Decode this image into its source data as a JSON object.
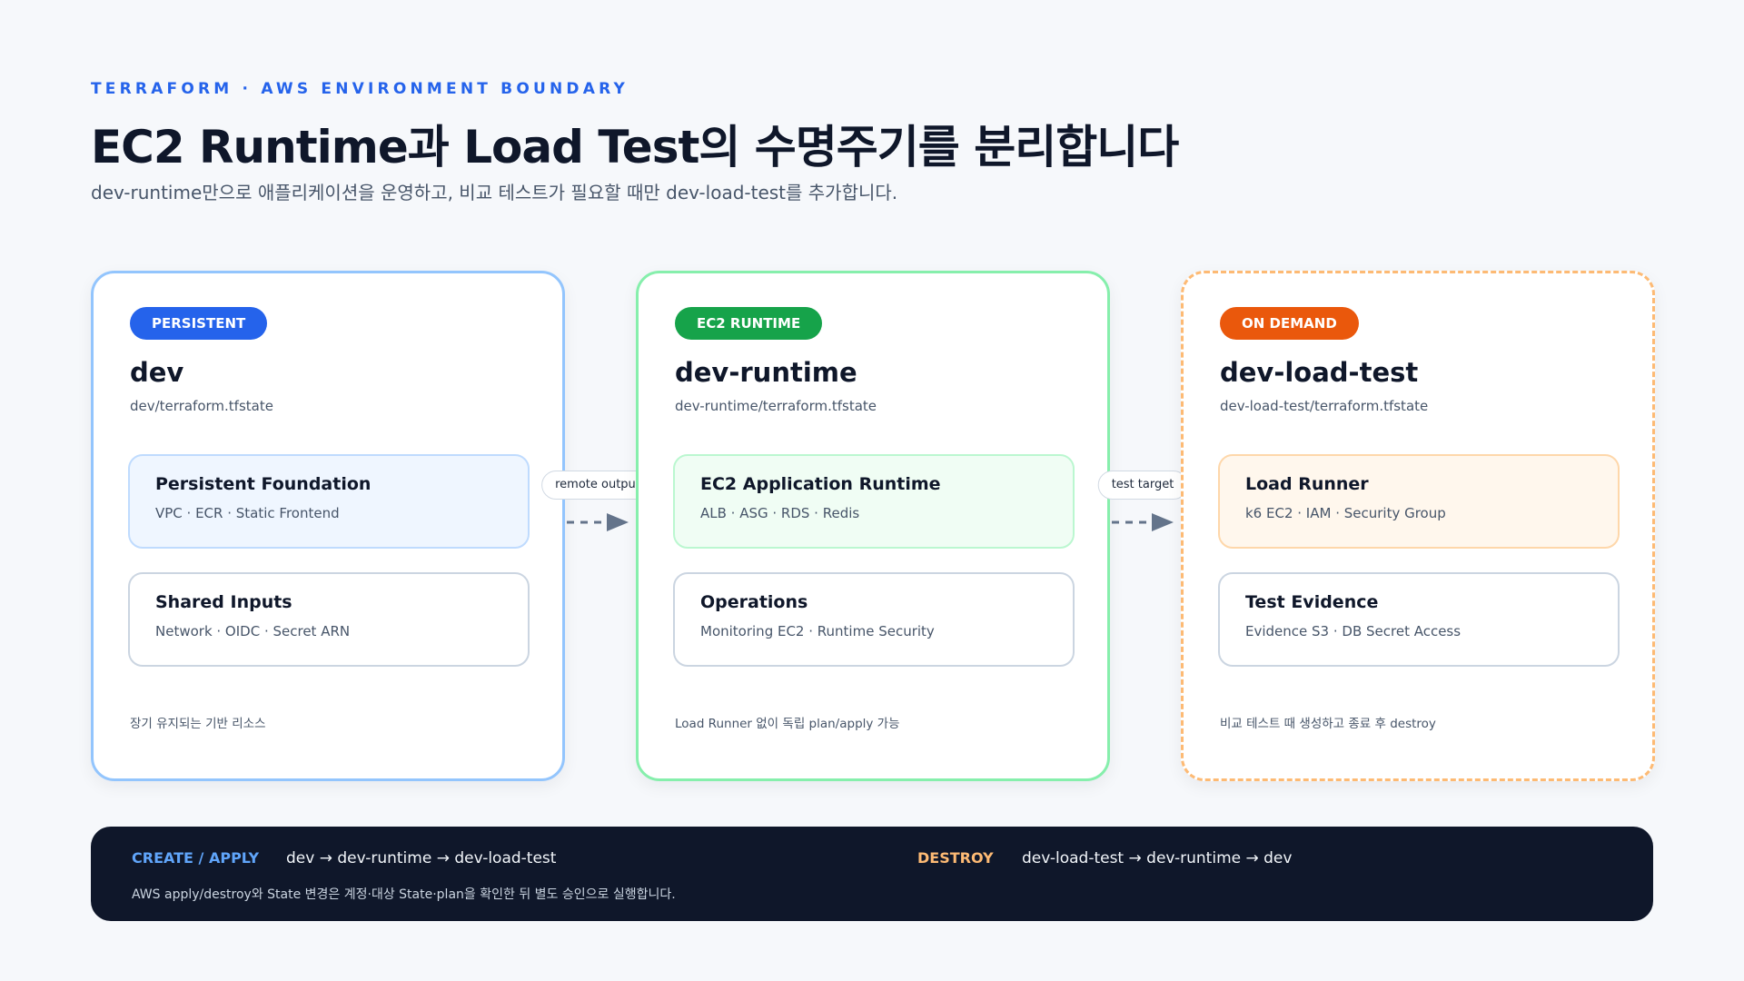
{
  "header": {
    "eyebrow": "TERRAFORM · AWS ENVIRONMENT BOUNDARY",
    "title": "EC2 Runtime과 Load Test의 수명주기를 분리합니다",
    "subtitle": "dev-runtime만으로 애플리케이션을 운영하고, 비교 테스트가 필요할 때만 dev-load-test를 추가합니다."
  },
  "cards": [
    {
      "badge": "PERSISTENT",
      "name": "dev",
      "state": "dev/terraform.tfstate",
      "primary": {
        "title": "Persistent Foundation",
        "desc": "VPC · ECR · Static Frontend"
      },
      "secondary": {
        "title": "Shared Inputs",
        "desc": "Network · OIDC · Secret ARN"
      },
      "note": "장기 유지되는 기반 리소스"
    },
    {
      "badge": "EC2 RUNTIME",
      "name": "dev-runtime",
      "state": "dev-runtime/terraform.tfstate",
      "primary": {
        "title": "EC2 Application Runtime",
        "desc": "ALB · ASG · RDS · Redis"
      },
      "secondary": {
        "title": "Operations",
        "desc": "Monitoring EC2 · Runtime Security"
      },
      "note": "Load Runner 없이 독립 plan/apply 가능"
    },
    {
      "badge": "ON DEMAND",
      "name": "dev-load-test",
      "state": "dev-load-test/terraform.tfstate",
      "primary": {
        "title": "Load Runner",
        "desc": "k6 EC2 · IAM · Security Group"
      },
      "secondary": {
        "title": "Test Evidence",
        "desc": "Evidence S3 · DB Secret Access"
      },
      "note": "비교 테스트 때 생성하고 종료 후 destroy"
    }
  ],
  "connectors": [
    {
      "label": "remote output"
    },
    {
      "label": "test target"
    }
  ],
  "footer": {
    "create_label": "CREATE / APPLY",
    "create_flow": "dev → dev-runtime → dev-load-test",
    "destroy_label": "DESTROY",
    "destroy_flow": "dev-load-test → dev-runtime → dev",
    "note": "AWS apply/destroy와 State 변경은 계정·대상 State·plan을 확인한 뒤 별도 승인으로 실행합니다."
  },
  "colors": {
    "accent_blue": "#2563eb",
    "accent_green": "#16a34a",
    "accent_orange": "#ea580c",
    "footer_bg": "#0f172a"
  }
}
